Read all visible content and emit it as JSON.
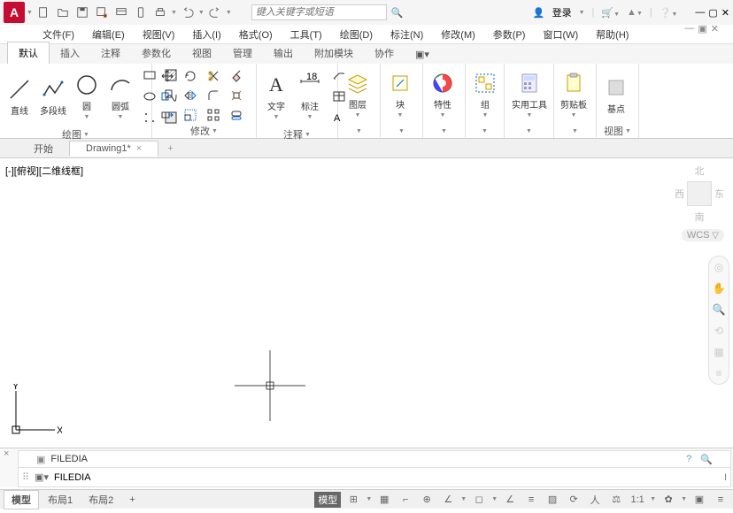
{
  "title": {
    "search_placeholder": "键入关键字或短语",
    "login": "登录"
  },
  "menus": [
    "文件(F)",
    "编辑(E)",
    "视图(V)",
    "插入(I)",
    "格式(O)",
    "工具(T)",
    "绘图(D)",
    "标注(N)",
    "修改(M)",
    "参数(P)",
    "窗口(W)",
    "帮助(H)"
  ],
  "ribbon_tabs": [
    "默认",
    "插入",
    "注释",
    "参数化",
    "视图",
    "管理",
    "输出",
    "附加模块",
    "协作"
  ],
  "panels": {
    "draw": {
      "label": "绘图",
      "btns": [
        "直线",
        "多段线",
        "圆",
        "圆弧"
      ]
    },
    "modify": {
      "label": "修改"
    },
    "annot": {
      "label": "注释",
      "btns": [
        "文字",
        "标注"
      ]
    },
    "layer": {
      "label": "图层"
    },
    "block": {
      "label": "块"
    },
    "props": {
      "label": "特性"
    },
    "group": {
      "label": "组"
    },
    "util": {
      "label": "实用工具"
    },
    "clip": {
      "label": "剪贴板"
    },
    "base": {
      "label": "基点"
    },
    "view": {
      "label": "视图"
    }
  },
  "doctabs": {
    "start": "开始",
    "current": "Drawing1*"
  },
  "canvas": {
    "viewlabel": "[-][俯视][二维线框]",
    "nav": {
      "n": "北",
      "s": "南",
      "w": "西",
      "e": "东"
    },
    "wcs": "WCS",
    "axes": {
      "x": "X",
      "y": "Y"
    }
  },
  "command": {
    "history": "FILEDIA",
    "input": "FILEDIA"
  },
  "status": {
    "tabs": [
      "模型",
      "布局1",
      "布局2"
    ],
    "model": "模型",
    "scale": "1:1"
  }
}
